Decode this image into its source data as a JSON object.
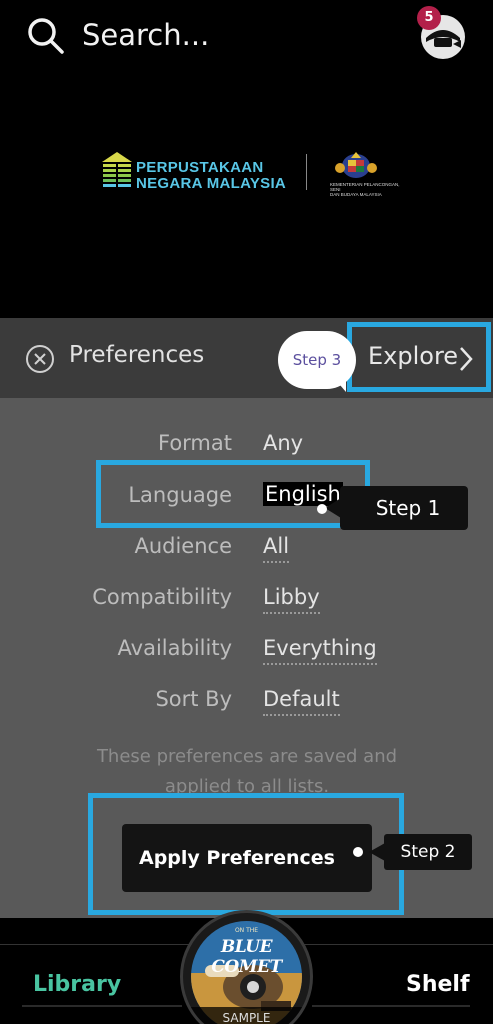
{
  "header": {
    "search_placeholder": "Search...",
    "notification_count": "5",
    "logo_line1": "PERPUSTAKAAN",
    "logo_line2": "NEGARA MALAYSIA",
    "ministry_line1": "KEMENTERIAN PELANCONGAN, SENI",
    "ministry_line2": "DAN BUDAYA MALAYSIA"
  },
  "preferences": {
    "title": "Preferences",
    "explore_label": "Explore",
    "rows": [
      {
        "label": "Format",
        "value": "Any"
      },
      {
        "label": "Language",
        "value": "English"
      },
      {
        "label": "Audience",
        "value": "All"
      },
      {
        "label": "Compatibility",
        "value": "Libby"
      },
      {
        "label": "Availability",
        "value": "Everything"
      },
      {
        "label": "Sort By",
        "value": "Default"
      }
    ],
    "note": "These preferences are saved and applied to all lists.",
    "apply_label": "Apply Preferences"
  },
  "annotations": {
    "step1": "Step 1",
    "step2": "Step 2",
    "step3": "Step 3",
    "highlight_color": "#29a8e0"
  },
  "bottom_nav": {
    "library_label": "Library",
    "shelf_label": "Shelf",
    "cover_small": "ON THE",
    "cover_title": "BLUE COMET",
    "sample_label": "SAMPLE",
    "library_color": "#49c4a1"
  }
}
